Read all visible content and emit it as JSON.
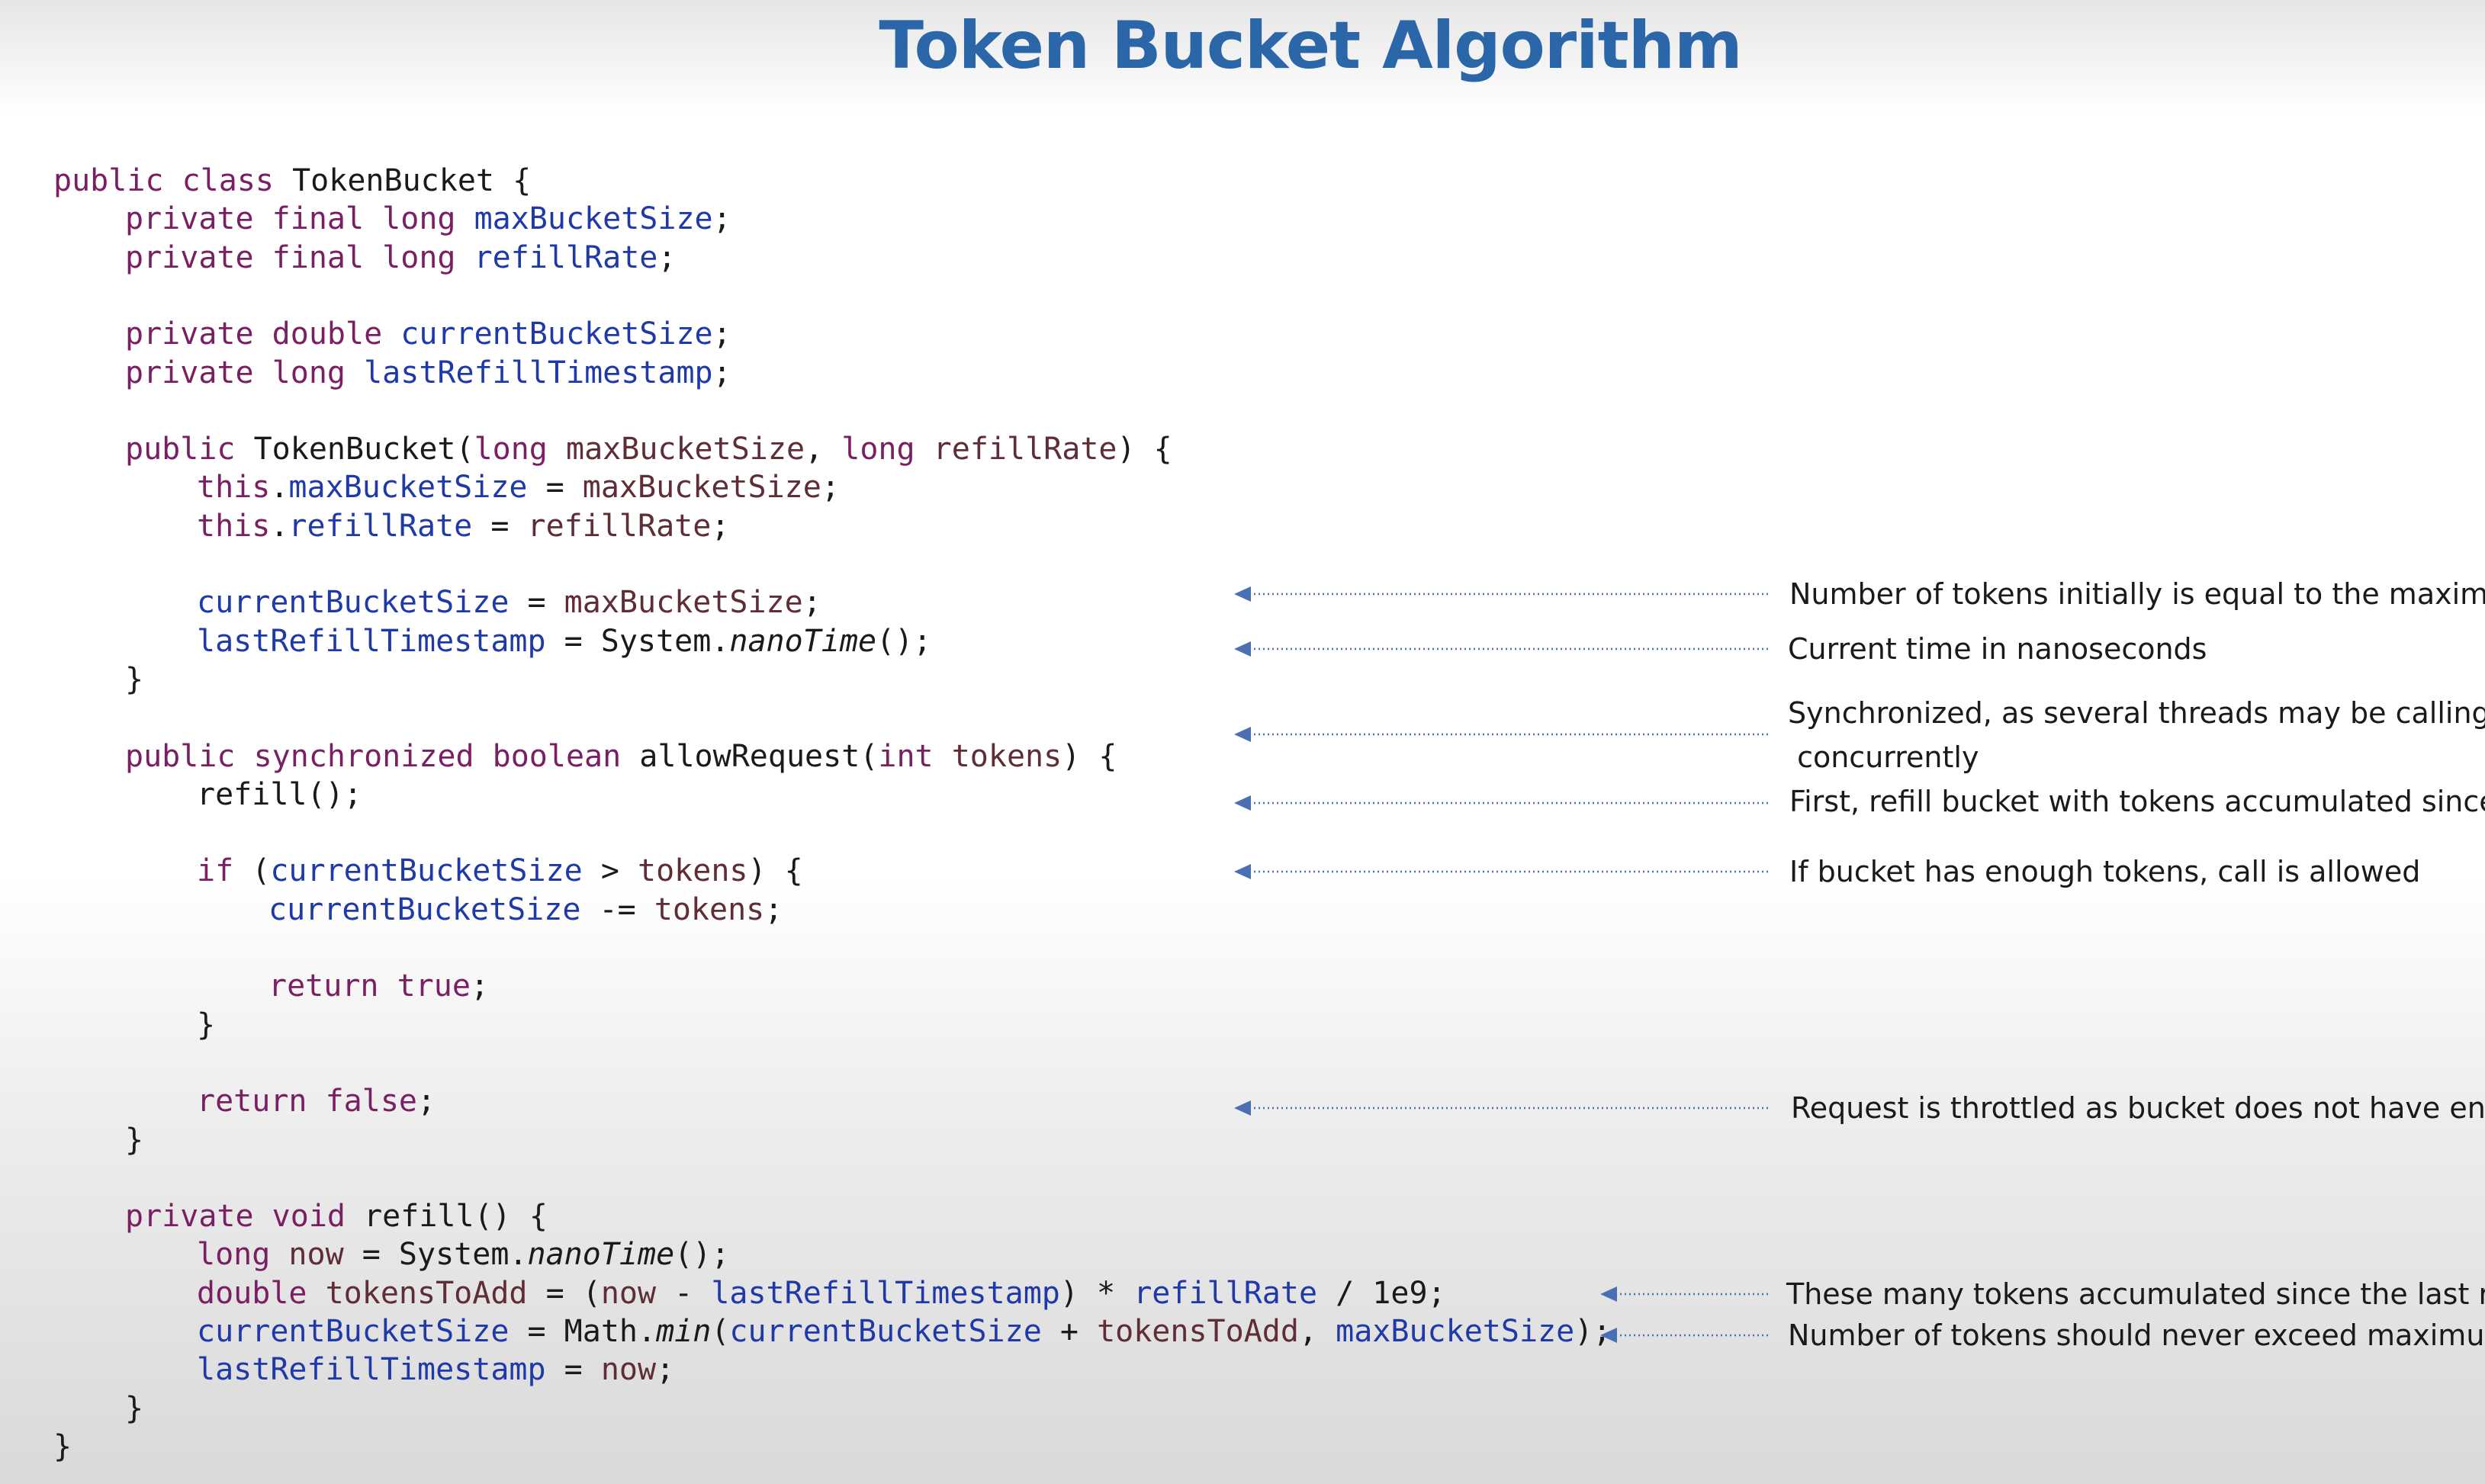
{
  "title": "Token Bucket Algorithm",
  "colors": {
    "title": "#2a66a8",
    "keyword": "#7a1f62",
    "field": "#1f3aa8",
    "variable": "#5e2d36",
    "text": "#1a1a1a",
    "arrow": "#4a6fb5"
  },
  "code_lines": [
    {
      "indent": 0,
      "tokens": [
        {
          "t": "public class ",
          "c": "kw"
        },
        {
          "t": "TokenBucket {"
        }
      ]
    },
    {
      "indent": 1,
      "tokens": [
        {
          "t": "private final long ",
          "c": "kw"
        },
        {
          "t": "maxBucketSize",
          "c": "fld"
        },
        {
          "t": ";"
        }
      ]
    },
    {
      "indent": 1,
      "tokens": [
        {
          "t": "private final long ",
          "c": "kw"
        },
        {
          "t": "refillRate",
          "c": "fld"
        },
        {
          "t": ";"
        }
      ]
    },
    {
      "indent": 0,
      "tokens": []
    },
    {
      "indent": 1,
      "tokens": [
        {
          "t": "private double ",
          "c": "kw"
        },
        {
          "t": "currentBucketSize",
          "c": "fld"
        },
        {
          "t": ";"
        }
      ]
    },
    {
      "indent": 1,
      "tokens": [
        {
          "t": "private long ",
          "c": "kw"
        },
        {
          "t": "lastRefillTimestamp",
          "c": "fld"
        },
        {
          "t": ";"
        }
      ]
    },
    {
      "indent": 0,
      "tokens": []
    },
    {
      "indent": 1,
      "tokens": [
        {
          "t": "public ",
          "c": "kw"
        },
        {
          "t": "TokenBucket("
        },
        {
          "t": "long ",
          "c": "kw"
        },
        {
          "t": "maxBucketSize",
          "c": "var"
        },
        {
          "t": ", "
        },
        {
          "t": "long ",
          "c": "kw"
        },
        {
          "t": "refillRate",
          "c": "var"
        },
        {
          "t": ") {"
        }
      ]
    },
    {
      "indent": 2,
      "tokens": [
        {
          "t": "this",
          "c": "kw"
        },
        {
          "t": "."
        },
        {
          "t": "maxBucketSize",
          "c": "fld"
        },
        {
          "t": " = "
        },
        {
          "t": "maxBucketSize",
          "c": "var"
        },
        {
          "t": ";"
        }
      ]
    },
    {
      "indent": 2,
      "tokens": [
        {
          "t": "this",
          "c": "kw"
        },
        {
          "t": "."
        },
        {
          "t": "refillRate",
          "c": "fld"
        },
        {
          "t": " = "
        },
        {
          "t": "refillRate",
          "c": "var"
        },
        {
          "t": ";"
        }
      ]
    },
    {
      "indent": 0,
      "tokens": []
    },
    {
      "indent": 2,
      "tokens": [
        {
          "t": "currentBucketSize",
          "c": "fld"
        },
        {
          "t": " = "
        },
        {
          "t": "maxBucketSize",
          "c": "var"
        },
        {
          "t": ";"
        }
      ]
    },
    {
      "indent": 2,
      "tokens": [
        {
          "t": "lastRefillTimestamp",
          "c": "fld"
        },
        {
          "t": " = System."
        },
        {
          "t": "nanoTime",
          "c": "it"
        },
        {
          "t": "();"
        }
      ]
    },
    {
      "indent": 1,
      "tokens": [
        {
          "t": "}"
        }
      ]
    },
    {
      "indent": 0,
      "tokens": []
    },
    {
      "indent": 1,
      "tokens": [
        {
          "t": "public synchronized boolean ",
          "c": "kw"
        },
        {
          "t": "allowRequest("
        },
        {
          "t": "int ",
          "c": "kw"
        },
        {
          "t": "tokens",
          "c": "var"
        },
        {
          "t": ") {"
        }
      ]
    },
    {
      "indent": 2,
      "tokens": [
        {
          "t": "refill();"
        }
      ]
    },
    {
      "indent": 0,
      "tokens": []
    },
    {
      "indent": 2,
      "tokens": [
        {
          "t": "if ",
          "c": "kw"
        },
        {
          "t": "("
        },
        {
          "t": "currentBucketSize",
          "c": "fld"
        },
        {
          "t": " > "
        },
        {
          "t": "tokens",
          "c": "var"
        },
        {
          "t": ") {"
        }
      ]
    },
    {
      "indent": 3,
      "tokens": [
        {
          "t": "currentBucketSize",
          "c": "fld"
        },
        {
          "t": " -= "
        },
        {
          "t": "tokens",
          "c": "var"
        },
        {
          "t": ";"
        }
      ]
    },
    {
      "indent": 0,
      "tokens": []
    },
    {
      "indent": 3,
      "tokens": [
        {
          "t": "return true",
          "c": "kw"
        },
        {
          "t": ";"
        }
      ]
    },
    {
      "indent": 2,
      "tokens": [
        {
          "t": "}"
        }
      ]
    },
    {
      "indent": 0,
      "tokens": []
    },
    {
      "indent": 2,
      "tokens": [
        {
          "t": "return false",
          "c": "kw"
        },
        {
          "t": ";"
        }
      ]
    },
    {
      "indent": 1,
      "tokens": [
        {
          "t": "}"
        }
      ]
    },
    {
      "indent": 0,
      "tokens": []
    },
    {
      "indent": 1,
      "tokens": [
        {
          "t": "private void ",
          "c": "kw"
        },
        {
          "t": "refill() {"
        }
      ]
    },
    {
      "indent": 2,
      "tokens": [
        {
          "t": "long ",
          "c": "kw"
        },
        {
          "t": "now",
          "c": "var"
        },
        {
          "t": " = System."
        },
        {
          "t": "nanoTime",
          "c": "it"
        },
        {
          "t": "();"
        }
      ]
    },
    {
      "indent": 2,
      "tokens": [
        {
          "t": "double ",
          "c": "kw"
        },
        {
          "t": "tokensToAdd",
          "c": "var"
        },
        {
          "t": " = ("
        },
        {
          "t": "now",
          "c": "var"
        },
        {
          "t": " - "
        },
        {
          "t": "lastRefillTimestamp",
          "c": "fld"
        },
        {
          "t": ") * "
        },
        {
          "t": "refillRate",
          "c": "fld"
        },
        {
          "t": " / 1e9;"
        }
      ]
    },
    {
      "indent": 2,
      "tokens": [
        {
          "t": "currentBucketSize",
          "c": "fld"
        },
        {
          "t": " = Math."
        },
        {
          "t": "min",
          "c": "it"
        },
        {
          "t": "("
        },
        {
          "t": "currentBucketSize",
          "c": "fld"
        },
        {
          "t": " + "
        },
        {
          "t": "tokensToAdd",
          "c": "var"
        },
        {
          "t": ", "
        },
        {
          "t": "maxBucketSize",
          "c": "fld"
        },
        {
          "t": ");"
        }
      ]
    },
    {
      "indent": 2,
      "tokens": [
        {
          "t": "lastRefillTimestamp",
          "c": "fld"
        },
        {
          "t": " = "
        },
        {
          "t": "now",
          "c": "var"
        },
        {
          "t": ";"
        }
      ]
    },
    {
      "indent": 1,
      "tokens": [
        {
          "t": "}"
        }
      ]
    },
    {
      "indent": 0,
      "tokens": [
        {
          "t": "}"
        }
      ]
    }
  ],
  "annotations": [
    {
      "text": "Number of tokens initially is equal to the maximum capacity"
    },
    {
      "text": "Current time in nanoseconds"
    },
    {
      "text": "Synchronized, as several threads may be calling the method\n concurrently"
    },
    {
      "text": "First, refill bucket with tokens accumulated since the last call"
    },
    {
      "text": "If bucket has enough tokens, call is allowed"
    },
    {
      "text": "Request is throttled as bucket does not have enough tokens"
    },
    {
      "text": "These many tokens accumulated since the last refill"
    },
    {
      "text": "Number of tokens should never exceed maximum capacity"
    }
  ]
}
